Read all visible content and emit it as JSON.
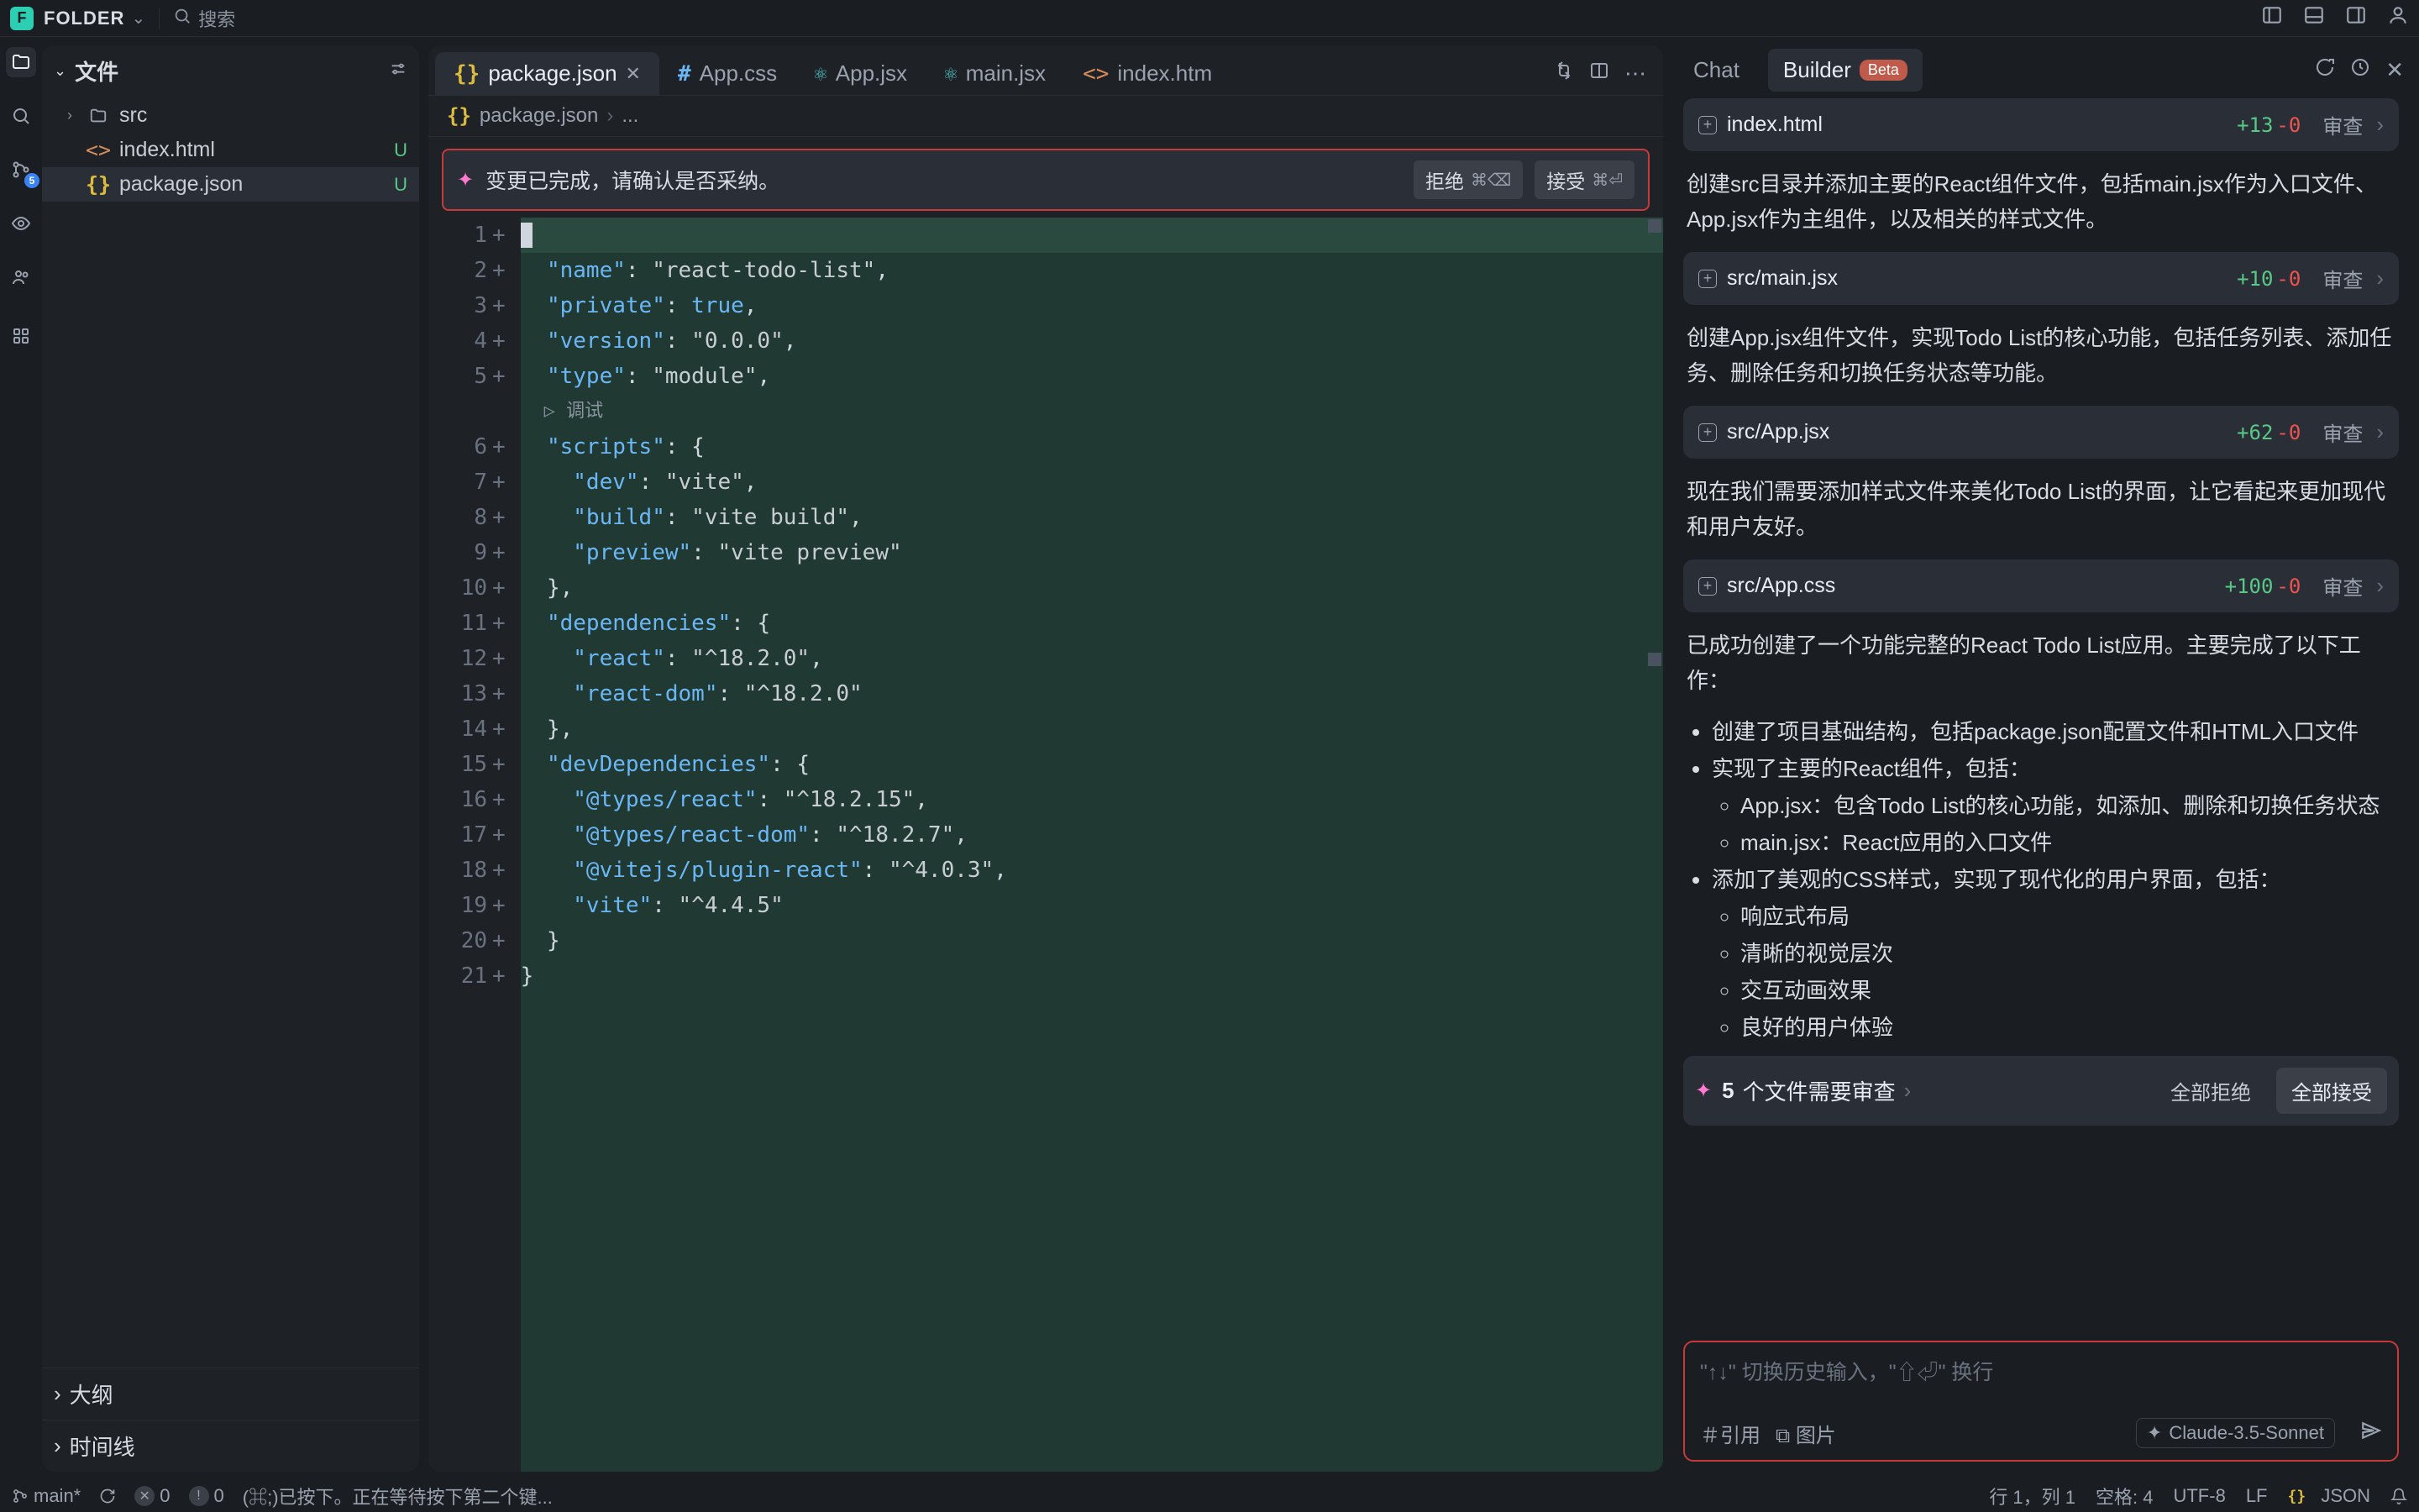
{
  "titlebar": {
    "app_letter": "F",
    "title": "FOLDER",
    "search_placeholder": "搜索"
  },
  "activity": {
    "badge_count": "5"
  },
  "sidebar": {
    "files_title": "文件",
    "outline_title": "大纲",
    "timeline_title": "时间线",
    "tree": [
      {
        "kind": "folder",
        "name": "src",
        "status_dot": true
      },
      {
        "kind": "html",
        "name": "index.html",
        "status": "U"
      },
      {
        "kind": "json",
        "name": "package.json",
        "status": "U",
        "selected": true
      }
    ]
  },
  "tabs": [
    {
      "icon": "json",
      "label": "package.json",
      "active": true,
      "closeable": true
    },
    {
      "icon": "css",
      "label": "App.css"
    },
    {
      "icon": "jsx",
      "label": "App.jsx"
    },
    {
      "icon": "jsx",
      "label": "main.jsx"
    },
    {
      "icon": "html",
      "label": "index.htm"
    }
  ],
  "breadcrumb": {
    "root": "package.json",
    "tail": "..."
  },
  "banner": {
    "text": "变更已完成，请确认是否采纳。",
    "reject": "拒绝",
    "reject_kbd": "⌘⌫",
    "accept": "接受",
    "accept_kbd": "⌘⏎"
  },
  "code": {
    "debug_label": "调试",
    "lines": [
      "{",
      "  \"name\": \"react-todo-list\",",
      "  \"private\": true,",
      "  \"version\": \"0.0.0\",",
      "  \"type\": \"module\",",
      "  \"scripts\": {",
      "    \"dev\": \"vite\",",
      "    \"build\": \"vite build\",",
      "    \"preview\": \"vite preview\"",
      "  },",
      "  \"dependencies\": {",
      "    \"react\": \"^18.2.0\",",
      "    \"react-dom\": \"^18.2.0\"",
      "  },",
      "  \"devDependencies\": {",
      "    \"@types/react\": \"^18.2.15\",",
      "    \"@types/react-dom\": \"^18.2.7\",",
      "    \"@vitejs/plugin-react\": \"^4.0.3\",",
      "    \"vite\": \"^4.4.5\"",
      "  }",
      "}"
    ]
  },
  "ai": {
    "tab_chat": "Chat",
    "tab_builder": "Builder",
    "beta": "Beta",
    "cards": {
      "index_html": {
        "name": "index.html",
        "add": "+13",
        "del": "-0",
        "review": "审查"
      },
      "main_jsx": {
        "name": "src/main.jsx",
        "add": "+10",
        "del": "-0",
        "review": "审查"
      },
      "app_jsx": {
        "name": "src/App.jsx",
        "add": "+62",
        "del": "-0",
        "review": "审查"
      },
      "app_css": {
        "name": "src/App.css",
        "add": "+100",
        "del": "-0",
        "review": "审查"
      }
    },
    "p1": "创建src目录并添加主要的React组件文件，包括main.jsx作为入口文件、App.jsx作为主组件，以及相关的样式文件。",
    "p2": "创建App.jsx组件文件，实现Todo List的核心功能，包括任务列表、添加任务、删除任务和切换任务状态等功能。",
    "p3": "现在我们需要添加样式文件来美化Todo List的界面，让它看起来更加现代和用户友好。",
    "p4": "已成功创建了一个功能完整的React Todo List应用。主要完成了以下工作：",
    "b1": "创建了项目基础结构，包括package.json配置文件和HTML入口文件",
    "b2": "实现了主要的React组件，包括：",
    "b2a": "App.jsx：包含Todo List的核心功能，如添加、删除和切换任务状态",
    "b2b": "main.jsx：React应用的入口文件",
    "b3": "添加了美观的CSS样式，实现了现代化的用户界面，包括：",
    "b3a": "响应式布局",
    "b3b": "清晰的视觉层次",
    "b3c": "交互动画效果",
    "b3d": "良好的用户体验",
    "actionbar": {
      "count": "5",
      "label": "个文件需要审查",
      "reject_all": "全部拒绝",
      "accept_all": "全部接受"
    },
    "input": {
      "placeholder": "\"↑↓\" 切换历史输入，\"⇧⏎\" 换行",
      "cite": "引用",
      "image": "图片",
      "model": "Claude-3.5-Sonnet"
    }
  },
  "statusbar": {
    "branch": "main*",
    "err": "0",
    "warn": "0",
    "key_msg": "(⌘;)已按下。正在等待按下第二个键...",
    "cursor": "行 1，列 1",
    "spaces": "空格: 4",
    "encoding": "UTF-8",
    "eol": "LF",
    "lang": "JSON"
  }
}
